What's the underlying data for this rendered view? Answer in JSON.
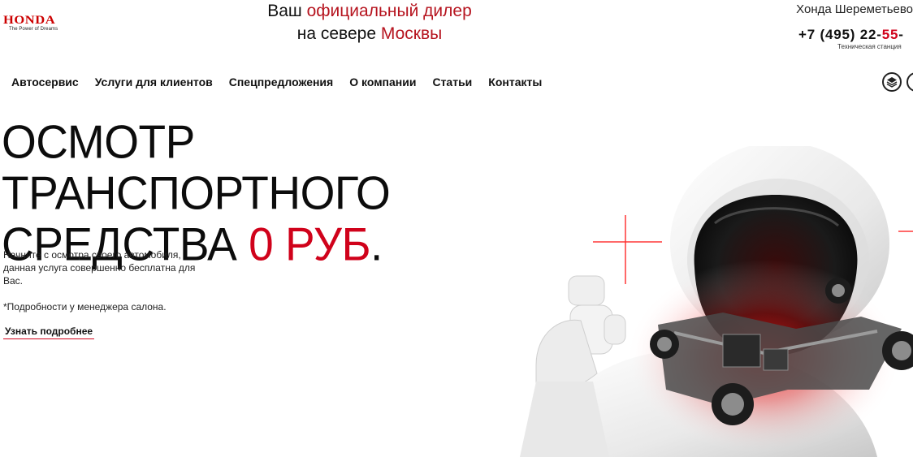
{
  "logo": {
    "brand": "HONDA",
    "tagline": "The Power of Dreams"
  },
  "header": {
    "dealer_line1_prefix": "Ваш ",
    "dealer_line1_accent": "официальный дилер",
    "dealer_line2_prefix": "на севере ",
    "dealer_line2_accent": "Москвы",
    "contact_name": "Хонда Шереметьево",
    "phone_main": "+7 (495) 22-",
    "phone_accent": "55",
    "phone_tail": "-",
    "phone_note": "Техническая станция"
  },
  "nav": {
    "items": [
      {
        "label": "Автосервис"
      },
      {
        "label": "Услуги для клиентов"
      },
      {
        "label": "Спецпредложения"
      },
      {
        "label": "О компании"
      },
      {
        "label": "Статьи"
      },
      {
        "label": "Контакты"
      }
    ],
    "icons": [
      "layers-icon",
      "circle-icon"
    ]
  },
  "hero": {
    "title_line1": "ОСМОТР ТРАНСПОРТНОГО",
    "title_line2_prefix": "СРЕДСТВА ",
    "title_price": "0 РУБ",
    "title_dot": ".",
    "description": "Начните с осмотра своего автомобиля, данная услуга совершенно бесплатна для Вас.",
    "note": "*Подробности у менеджера салона.",
    "more_label": "Узнать подробнее"
  },
  "colors": {
    "accent": "#d0021b",
    "brand_red": "#cc0000",
    "text": "#111111",
    "background": "#ffffff"
  }
}
